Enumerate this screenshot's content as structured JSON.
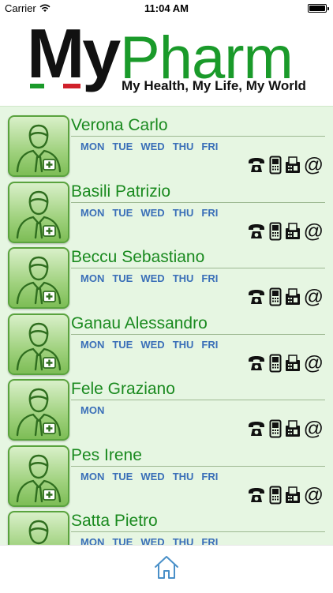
{
  "status": {
    "carrier": "Carrier",
    "time": "11:04 AM"
  },
  "header": {
    "logo_my": "My",
    "logo_pharm": "Pharm",
    "tagline": "My Health, My Life, My World"
  },
  "doctors": [
    {
      "name": "Verona Carlo",
      "days": [
        "MON",
        "TUE",
        "WED",
        "THU",
        "FRI"
      ]
    },
    {
      "name": "Basili Patrizio",
      "days": [
        "MON",
        "TUE",
        "WED",
        "THU",
        "FRI"
      ]
    },
    {
      "name": "Beccu Sebastiano",
      "days": [
        "MON",
        "TUE",
        "WED",
        "THU",
        "FRI"
      ]
    },
    {
      "name": "Ganau Alessandro",
      "days": [
        "MON",
        "TUE",
        "WED",
        "THU",
        "FRI"
      ]
    },
    {
      "name": "Fele Graziano",
      "days": [
        "MON"
      ]
    },
    {
      "name": "Pes Irene",
      "days": [
        "MON",
        "TUE",
        "WED",
        "THU",
        "FRI"
      ]
    },
    {
      "name": "Satta Pietro",
      "days": [
        "MON",
        "TUE",
        "WED",
        "THU",
        "FRI"
      ]
    }
  ],
  "contact_icons": {
    "phone": "phone-icon",
    "mobile": "mobile-icon",
    "fax": "fax-icon",
    "email": "@"
  },
  "icons": {
    "avatar": "doctor-avatar-icon",
    "home": "home-icon"
  },
  "colors": {
    "brand_green": "#1a9a2a",
    "list_background": "#e6f6e2",
    "days_blue": "#3a6fb8",
    "flag_red": "#d0202a"
  }
}
